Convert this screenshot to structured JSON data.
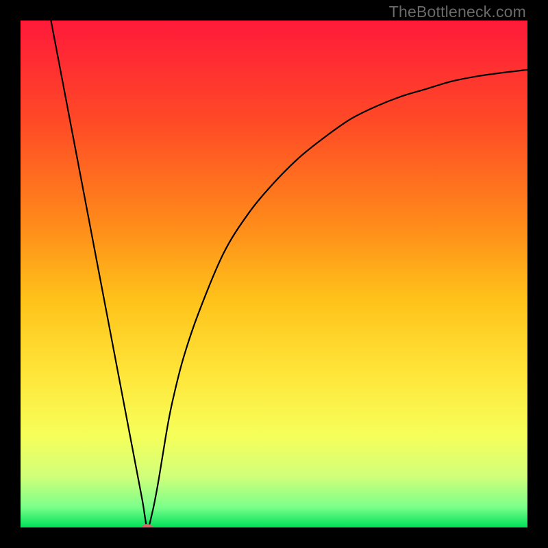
{
  "watermark": "TheBottleneck.com",
  "chart_data": {
    "type": "line",
    "title": "",
    "xlabel": "",
    "ylabel": "",
    "xlim": [
      0,
      100
    ],
    "ylim": [
      0,
      100
    ],
    "grid": false,
    "legend": false,
    "background_gradient": {
      "stops": [
        {
          "offset": 0.0,
          "color": "#ff1a3a"
        },
        {
          "offset": 0.2,
          "color": "#ff4a26"
        },
        {
          "offset": 0.4,
          "color": "#ff8a1a"
        },
        {
          "offset": 0.55,
          "color": "#ffc21a"
        },
        {
          "offset": 0.7,
          "color": "#ffe63a"
        },
        {
          "offset": 0.82,
          "color": "#f6ff5a"
        },
        {
          "offset": 0.9,
          "color": "#d0ff7a"
        },
        {
          "offset": 0.96,
          "color": "#7aff8a"
        },
        {
          "offset": 1.0,
          "color": "#00e05a"
        }
      ]
    },
    "series": [
      {
        "name": "bottleneck-curve",
        "x": [
          6,
          8,
          10,
          12,
          14,
          16,
          18,
          20,
          22,
          24,
          25,
          26,
          27,
          28,
          29,
          30,
          32,
          35,
          40,
          45,
          50,
          55,
          60,
          65,
          70,
          75,
          80,
          85,
          90,
          95,
          100
        ],
        "y": [
          100,
          89.5,
          79,
          68.5,
          58,
          47.5,
          37,
          26.5,
          16,
          5.5,
          0,
          3,
          8,
          14,
          20,
          25,
          33,
          42,
          54,
          62,
          68,
          73,
          77,
          80.5,
          83,
          85,
          86.5,
          88,
          89,
          89.7,
          90.3
        ]
      }
    ],
    "marker": {
      "name": "minimum-point",
      "x": 25,
      "y": 0,
      "color": "#d86a6a",
      "rx": 8,
      "ry": 5
    }
  }
}
